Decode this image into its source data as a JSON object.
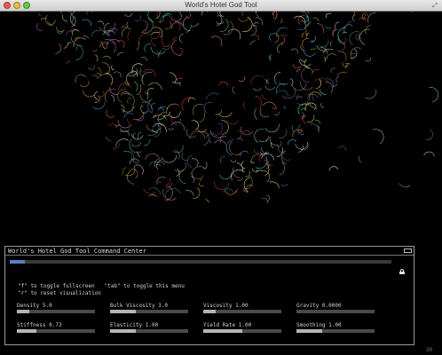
{
  "window": {
    "title": "World's Hotel God Tool"
  },
  "panel": {
    "title": "World's Hotel God Tool Command Center",
    "top_slider_fraction": 0.04,
    "help_lines": [
      "\"f\" to toggle fullscreen   \"tab\" to toggle this menu",
      "\"r\" to reset visualization"
    ],
    "params": [
      {
        "label": "Density 5.0",
        "fraction": 0.16
      },
      {
        "label": "Bulk Viscosity 3.0",
        "fraction": 0.33
      },
      {
        "label": "Viscosity 1.00",
        "fraction": 0.16
      },
      {
        "label": "Gravity 0.0000",
        "fraction": 0.0
      },
      {
        "label": "Stiffness 0.73",
        "fraction": 0.25
      },
      {
        "label": "Elasticity 1.00",
        "fraction": 0.33
      },
      {
        "label": "Yield Rate 1.00",
        "fraction": 0.5
      },
      {
        "label": "Smoothing 1.00",
        "fraction": 0.33
      }
    ]
  },
  "fps": "30",
  "colors": {
    "background": "#000000",
    "particles": [
      "#e64a3c",
      "#f0a040",
      "#e8d070",
      "#9fd27a",
      "#4fb0d8",
      "#c070c0",
      "#e0e0d0",
      "#6ad0b0"
    ]
  }
}
